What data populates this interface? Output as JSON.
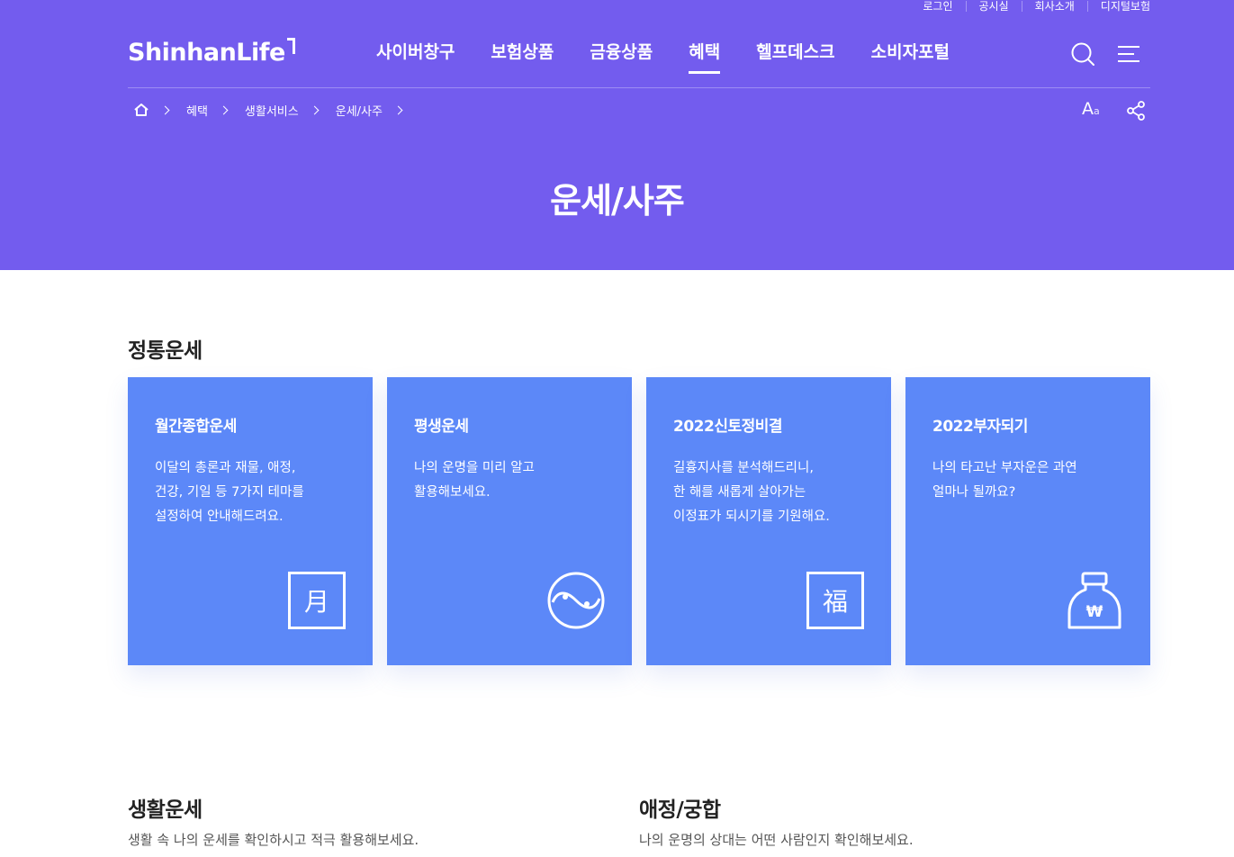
{
  "utility": [
    "로그인",
    "공시실",
    "회사소개",
    "디지털보험"
  ],
  "logo": {
    "text": "ShinhanLife"
  },
  "gnb": [
    {
      "label": "사이버창구",
      "active": false
    },
    {
      "label": "보험상품",
      "active": false
    },
    {
      "label": "금융상품",
      "active": false
    },
    {
      "label": "혜택",
      "active": true
    },
    {
      "label": "헬프데스크",
      "active": false
    },
    {
      "label": "소비자포털",
      "active": false
    }
  ],
  "icons": {
    "search": "search-icon",
    "menu": "hamburger-menu-icon",
    "home": "home-icon",
    "font": "font-size-icon",
    "share": "share-icon"
  },
  "breadcrumb": [
    "혜택",
    "생활서비스",
    "운세/사주"
  ],
  "font_control": {
    "big": "A",
    "small": "a"
  },
  "page_title": "운세/사주",
  "sections": {
    "traditional": {
      "title": "정통운세",
      "cards": [
        {
          "title": "월간종합운세",
          "desc": "이달의 총론과 재물, 애정,\n건강, 기일 등 7가지 테마를\n설정하여 안내해드려요.",
          "icon": "moon-character-icon",
          "glyph": "月"
        },
        {
          "title": "평생운세",
          "desc": "나의 운명을 미리 알고\n활용해보세요.",
          "icon": "yin-yang-icon",
          "glyph": ""
        },
        {
          "title": "2022신토정비결",
          "desc": "길흉지사를 분석해드리니,\n한 해를 새롭게 살아가는\n이정표가 되시기를 기원해요.",
          "icon": "fortune-character-icon",
          "glyph": "福"
        },
        {
          "title": "2022부자되기",
          "desc": "나의 타고난 부자운은 과연\n얼마나 될까요?",
          "icon": "money-bag-icon",
          "glyph": "₩"
        }
      ]
    },
    "life": {
      "title": "생활운세",
      "desc": "생활 속 나의 운세를 확인하시고 적극 활용해보세요."
    },
    "love": {
      "title": "애정/궁합",
      "desc": "나의 운명의 상대는 어떤 사람인지 확인해보세요."
    }
  },
  "colors": {
    "header_bg": "#735cee",
    "card_bg": "#5c88f8",
    "text_dark": "#222222"
  }
}
